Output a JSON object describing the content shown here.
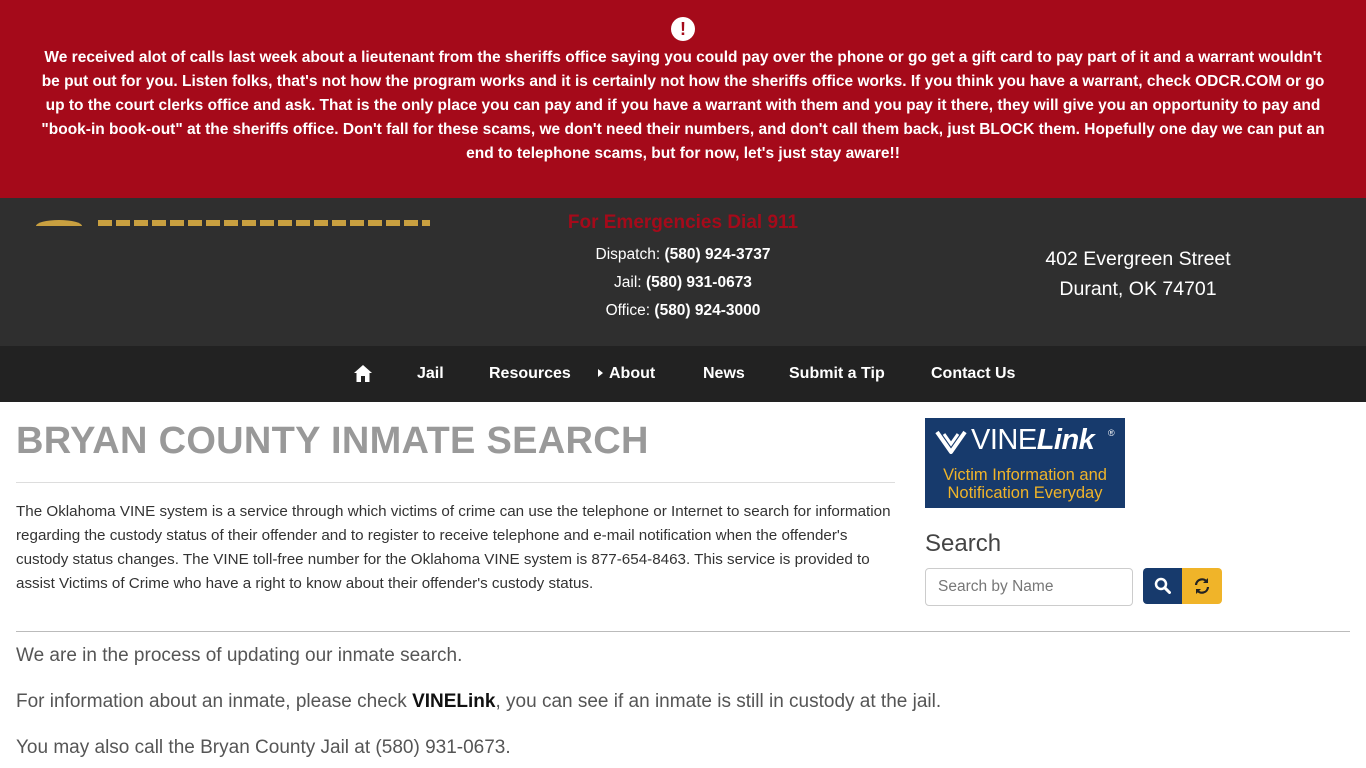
{
  "alert": {
    "icon": "exclamation-circle-icon",
    "message": "We received alot of calls last week about a lieutenant from the sheriffs office saying you could pay over the phone or go get a gift card to pay part of it and a warrant wouldn't be put out for you. Listen folks, that's not how the program works and it is certainly not how the sheriffs office works. If you think you have a warrant, check ODCR.COM or go up to the court clerks office and ask. That is the only place you can pay and if you have a warrant with them and you pay it there, they will give you an opportunity to pay and \"book-in book-out\" at the sheriffs office. Don't fall for these scams, we don't need their numbers, and don't call them back, just BLOCK them. Hopefully one day we can put an end to telephone scams, but for now, let's just stay aware!!"
  },
  "header": {
    "emergency": "For Emergencies Dial 911",
    "dispatch_label": "Dispatch:",
    "dispatch_phone": "(580) 924-3737",
    "jail_label": "Jail:",
    "jail_phone": "(580) 931-0673",
    "office_label": "Office:",
    "office_phone": "(580) 924-3000",
    "address_line1": "402 Evergreen Street",
    "address_line2": "Durant, OK 74701"
  },
  "nav": {
    "home_icon": "home-icon",
    "items": [
      {
        "label": "Jail"
      },
      {
        "label": "Resources"
      },
      {
        "label": "About"
      },
      {
        "label": "News"
      },
      {
        "label": "Submit a Tip"
      },
      {
        "label": "Contact Us"
      }
    ]
  },
  "main": {
    "title": "BRYAN COUNTY INMATE SEARCH",
    "intro": "The Oklahoma VINE system is a service through which victims of crime can use the telephone or Internet to search for information regarding the custody status of their offender and to register to receive telephone and e-mail notification when the offender's custody status changes. The VINE toll-free number for the Oklahoma VINE system is 877-654-8463. This service is provided to assist Victims of Crime who have a right to know about their offender's custody status.",
    "para1": "We are in the process of updating our inmate search.",
    "para2_before": "For information about an inmate, please check ",
    "para2_link": "VINELink",
    "para2_after": ", you can see if an inmate is still in custody at the jail.",
    "para3": "You may also call the Bryan County Jail at (580) 931-0673."
  },
  "sidebar": {
    "vine_name_plain": "VINE",
    "vine_name_bold": "Link",
    "vine_reg": "®",
    "vine_tagline": "Victim Information and Notification Everyday",
    "search_title": "Search",
    "search_placeholder": "Search by Name",
    "search_button_icon": "search-icon",
    "reset_button_icon": "refresh-icon"
  },
  "colors": {
    "alert_bg": "#a50a1a",
    "header_bg": "#2f2f2f",
    "nav_bg": "#222222",
    "vine_blue": "#173a6c",
    "vine_gold": "#f0b429"
  }
}
